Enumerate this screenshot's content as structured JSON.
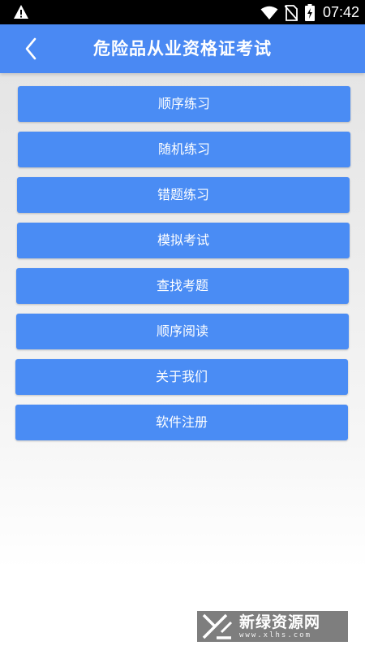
{
  "status_bar": {
    "time": "07:42",
    "icons": [
      "warning-icon",
      "wifi-icon",
      "no-sim-icon",
      "battery-charging-icon"
    ]
  },
  "app_bar": {
    "back_icon": "chevron-left-icon",
    "title": "危险品从业资格证考试"
  },
  "menu": {
    "items": [
      {
        "label": "顺序练习"
      },
      {
        "label": "随机练习"
      },
      {
        "label": "错题练习"
      },
      {
        "label": "模拟考试"
      },
      {
        "label": "查找考题"
      },
      {
        "label": "顺序阅读"
      },
      {
        "label": "关于我们"
      },
      {
        "label": "软件注册"
      }
    ]
  },
  "watermark": {
    "main": "新绿资源网",
    "sub": "www.xlhs.com"
  },
  "colors": {
    "accent": "#4a89f3",
    "button": "#4a8cf4",
    "status_bar": "#000000"
  }
}
